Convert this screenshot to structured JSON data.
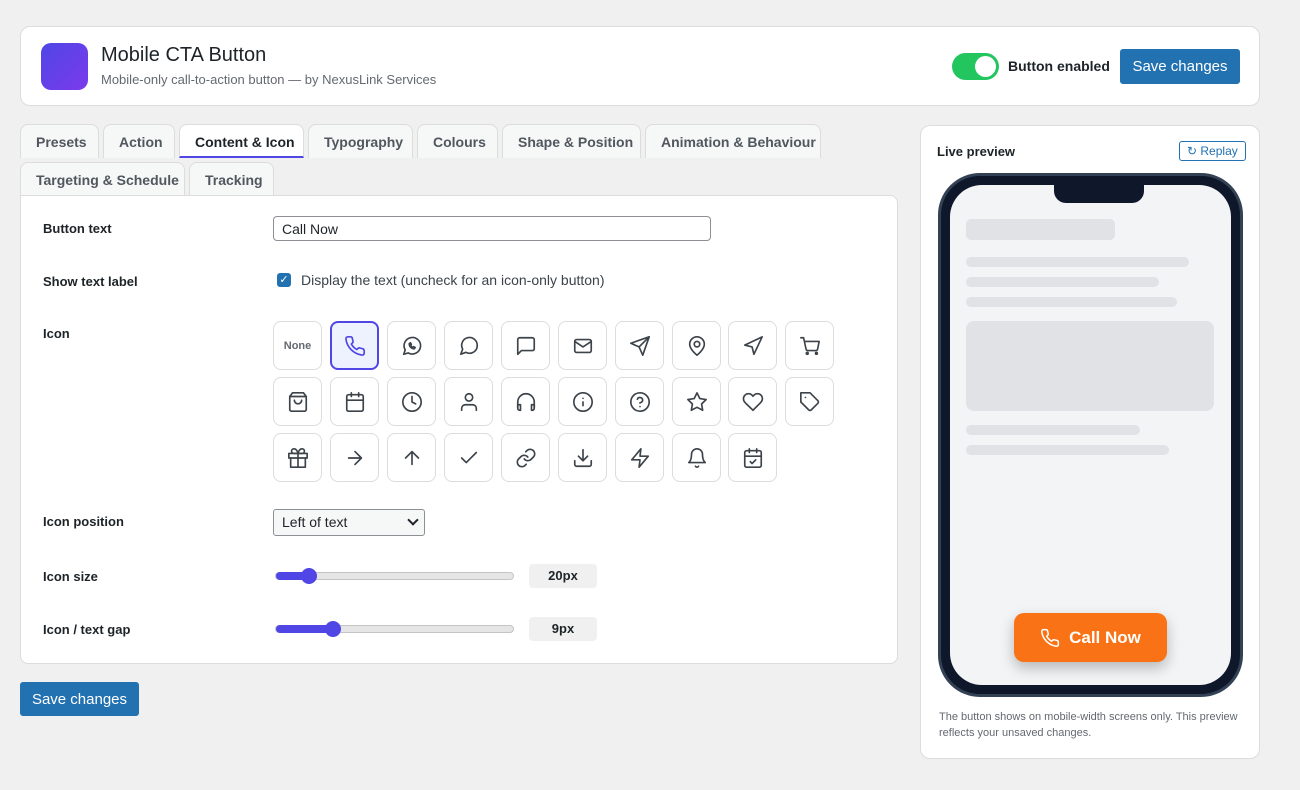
{
  "header": {
    "title": "Mobile CTA Button",
    "subtitle": "Mobile-only call-to-action button — by NexusLink Services",
    "toggle_label": "Button enabled",
    "toggle_on": true,
    "save_label": "Save changes"
  },
  "tabs": [
    {
      "label": "Presets"
    },
    {
      "label": "Action"
    },
    {
      "label": "Content & Icon",
      "active": true
    },
    {
      "label": "Typography"
    },
    {
      "label": "Colours"
    },
    {
      "label": "Shape & Position"
    },
    {
      "label": "Animation & Behaviour"
    },
    {
      "label": "Targeting & Schedule"
    },
    {
      "label": "Tracking"
    }
  ],
  "form": {
    "button_text_label": "Button text",
    "button_text_value": "Call Now",
    "show_label_label": "Show text label",
    "show_label_checked": true,
    "show_label_desc": "Display the text (uncheck for an icon-only button)",
    "icon_label": "Icon",
    "icon_none_label": "None",
    "icons": [
      "none",
      "phone-icon",
      "whatsapp-icon",
      "message-circle-icon",
      "message-square-icon",
      "mail-icon",
      "send-icon",
      "map-pin-icon",
      "navigation-icon",
      "shopping-cart-icon",
      "shopping-bag-icon",
      "calendar-icon",
      "clock-icon",
      "user-icon",
      "headphones-icon",
      "info-icon",
      "help-circle-icon",
      "star-icon",
      "heart-icon",
      "tag-icon",
      "gift-icon",
      "arrow-right-icon",
      "arrow-up-icon",
      "check-icon",
      "link-icon",
      "download-icon",
      "zap-icon",
      "bell-icon",
      "calendar-check-icon"
    ],
    "selected_icon": "phone-icon",
    "icon_position_label": "Icon position",
    "icon_position_value": "Left of text",
    "icon_size_label": "Icon size",
    "icon_size_value": "20px",
    "icon_size_fraction": 0.14,
    "gap_label": "Icon / text gap",
    "gap_value": "9px",
    "gap_fraction": 0.24
  },
  "footer": {
    "save_label": "Save changes"
  },
  "preview": {
    "title": "Live preview",
    "replay_label": "↻ Replay",
    "cta_text": "Call Now",
    "cta_color": "#f97316",
    "note": "The button shows on mobile-width screens only. This preview reflects your unsaved changes."
  },
  "colors": {
    "accent": "#4f46e5",
    "primary_button": "#2271b1",
    "toggle_on": "#22c55e"
  }
}
